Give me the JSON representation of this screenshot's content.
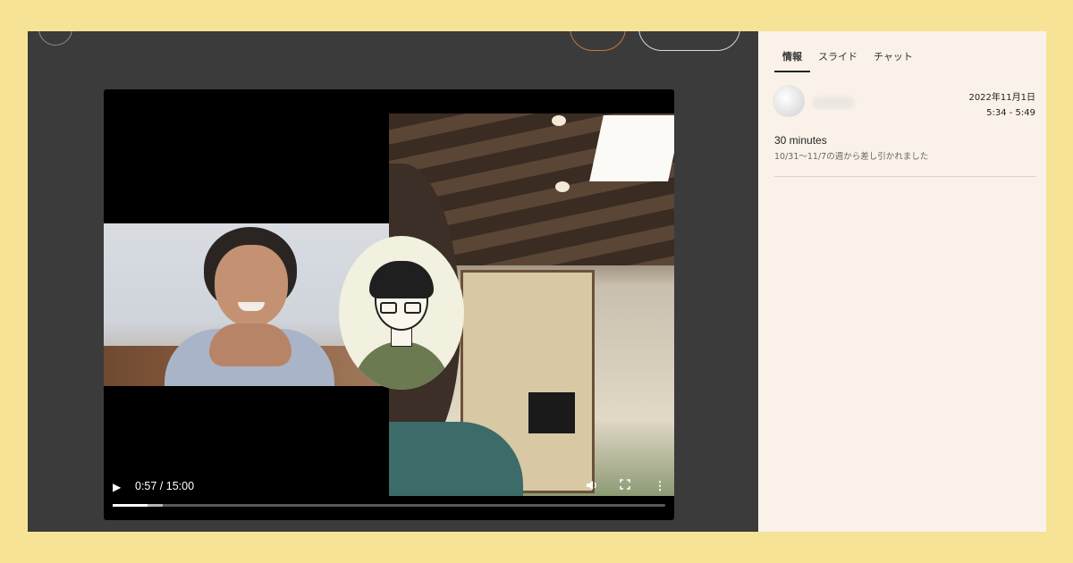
{
  "player": {
    "time_current": "0:57",
    "time_total": "15:00",
    "time_display": "0:57 / 15:00",
    "progress_fraction": 0.063,
    "buffered_fraction": 0.09,
    "icons": [
      "play-icon",
      "volume-icon",
      "fullscreen-icon",
      "more-icon"
    ]
  },
  "panel": {
    "tabs": [
      {
        "label": "情報",
        "active": true
      },
      {
        "label": "スライド",
        "active": false
      },
      {
        "label": "チャット",
        "active": false
      }
    ],
    "date": "2022年11月1日",
    "time_range": "5:34 - 5:49",
    "duration": "30 minutes",
    "deduction_note": "10/31〜11/7の週から差し引かれました"
  },
  "colors": {
    "background": "#f7e396",
    "stage": "#3b3b3b",
    "panel": "#faf2e8",
    "accent_orange": "#c8763d"
  }
}
